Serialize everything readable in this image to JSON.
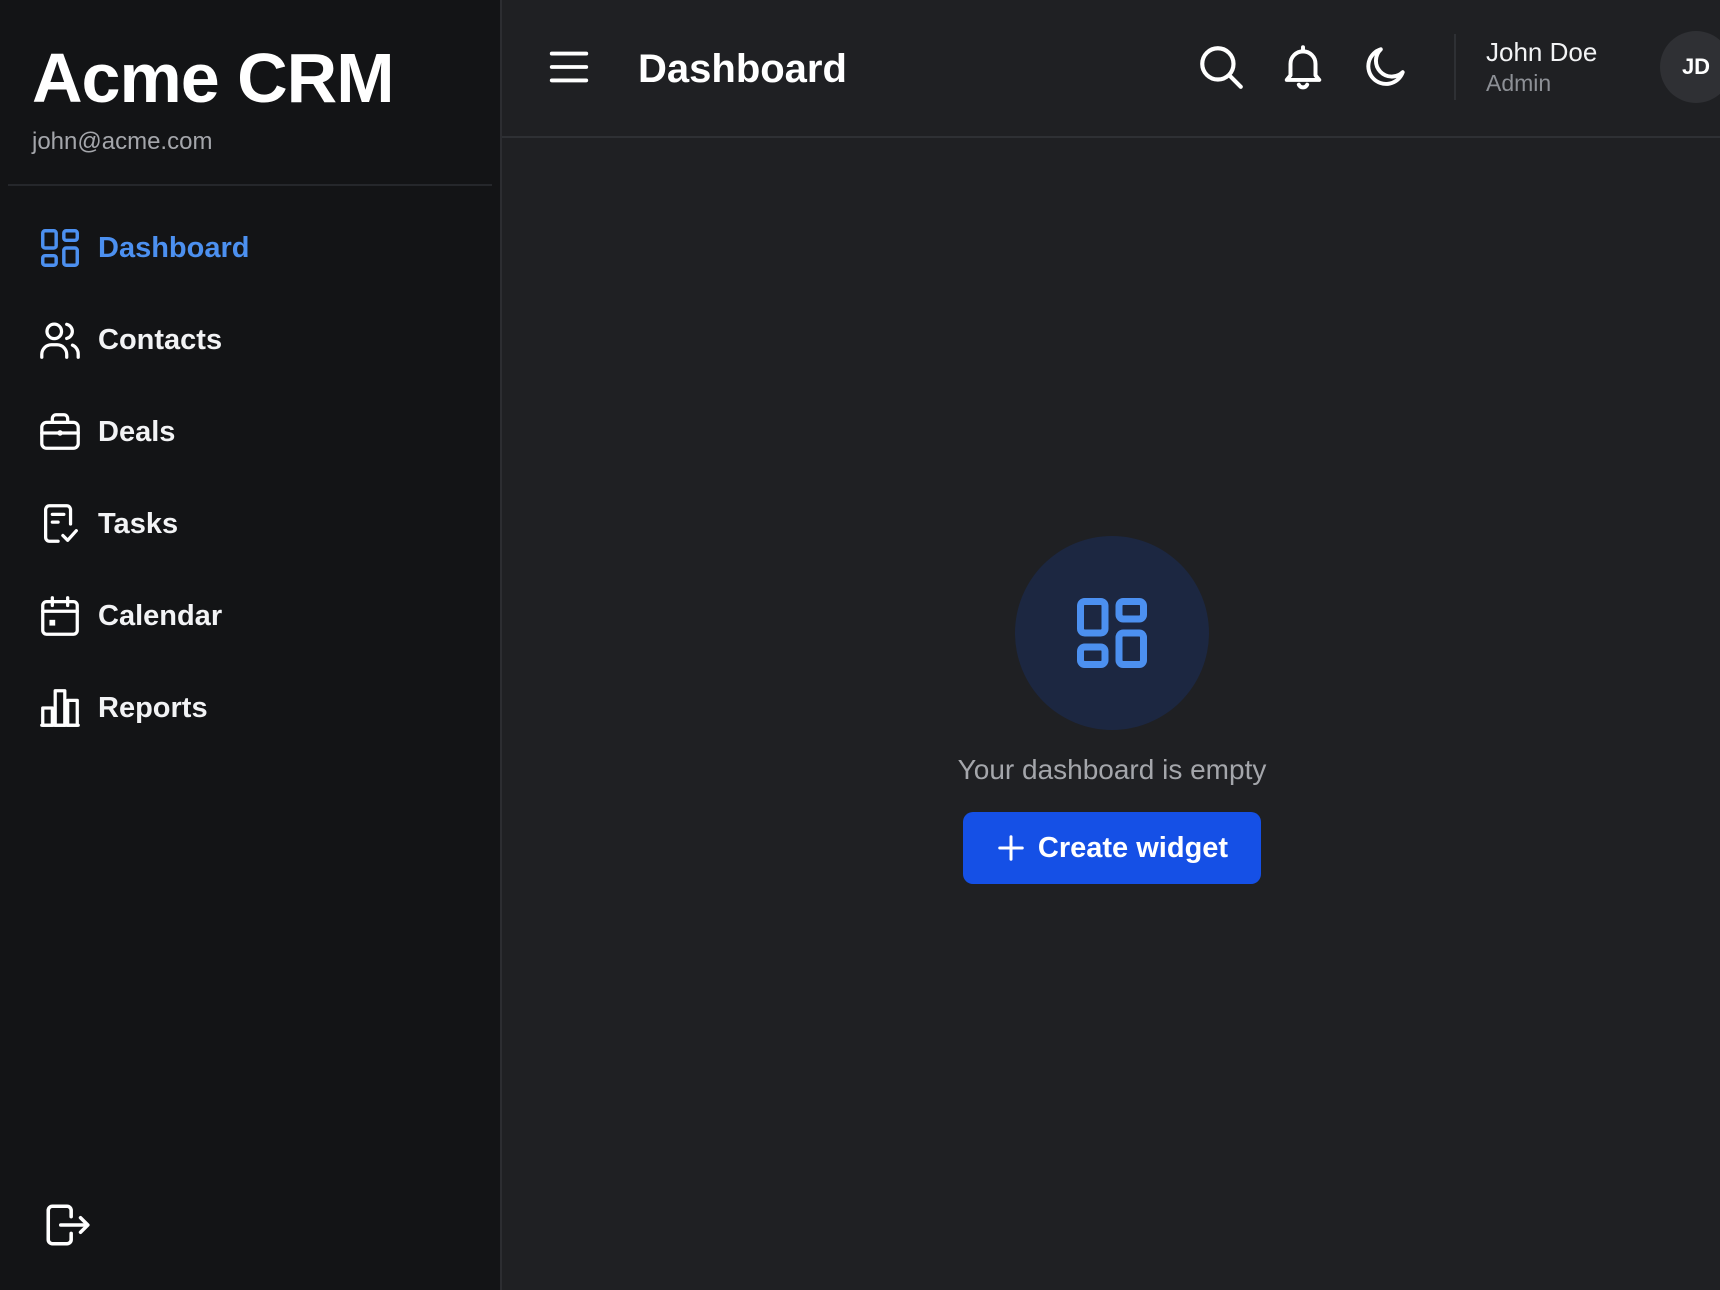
{
  "brand": {
    "title": "Acme CRM",
    "email": "john@acme.com"
  },
  "sidebar": {
    "items": [
      {
        "label": "Dashboard",
        "icon": "dashboard-icon",
        "active": true
      },
      {
        "label": "Contacts",
        "icon": "users-icon",
        "active": false
      },
      {
        "label": "Deals",
        "icon": "briefcase-icon",
        "active": false
      },
      {
        "label": "Tasks",
        "icon": "clipboard-check-icon",
        "active": false
      },
      {
        "label": "Calendar",
        "icon": "calendar-icon",
        "active": false
      },
      {
        "label": "Reports",
        "icon": "bar-chart-icon",
        "active": false
      }
    ],
    "logout_icon": "logout-icon"
  },
  "header": {
    "title": "Dashboard",
    "icons": [
      "menu-icon",
      "search-icon",
      "bell-icon",
      "moon-icon"
    ]
  },
  "user": {
    "name": "John Doe",
    "role": "Admin",
    "initials": "JD"
  },
  "empty_state": {
    "message": "Your dashboard is empty",
    "button_label": "Create widget",
    "icon": "dashboard-icon"
  },
  "colors": {
    "accent": "#4c90f0",
    "primary_button": "#1550e6",
    "sidebar_bg": "#131416",
    "main_bg": "#1f2023"
  }
}
